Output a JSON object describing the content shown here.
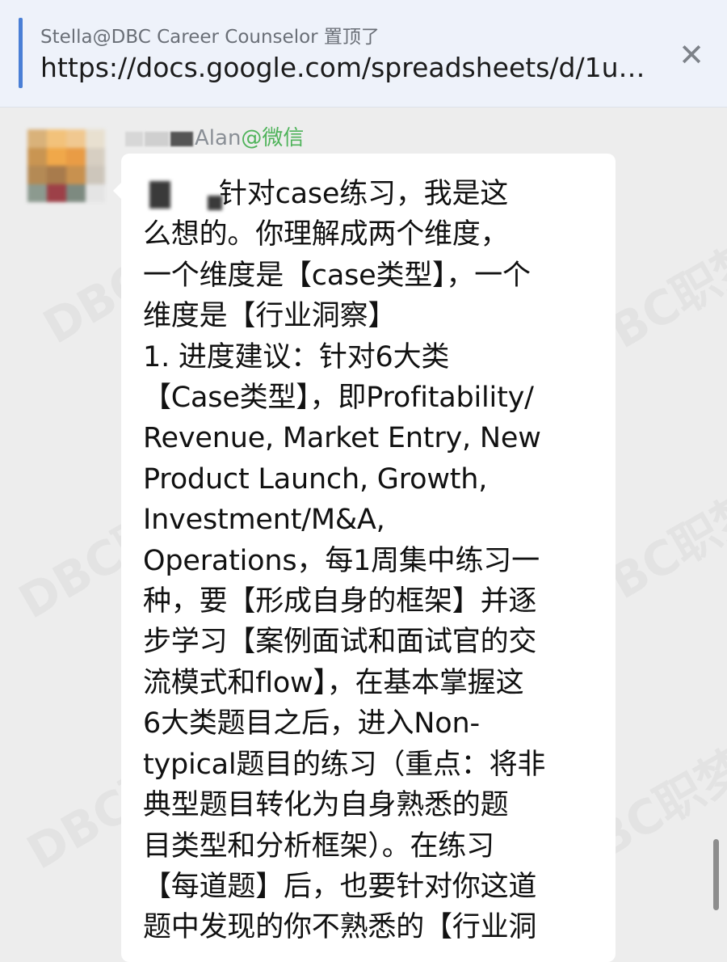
{
  "pinned": {
    "from_label": "Stella@DBC Career Counselor 置顶了",
    "url": "https://docs.google.com/spreadsheets/d/1uD...",
    "close_glyph": "✕"
  },
  "message": {
    "sender_name": "Alan",
    "sender_source": "@微信",
    "lines": [
      "针对case练习，我是这",
      "么想的。你理解成两个维度，",
      "一个维度是【case类型】，一个",
      "维度是【行业洞察】",
      "1. 进度建议：针对6大类",
      "【Case类型】，即Profitability/",
      "Revenue, Market Entry, New",
      "Product Launch, Growth,",
      "Investment/M&A,",
      "Operations，每1周集中练习一",
      "种，要【形成自身的框架】并逐",
      "步学习【案例面试和面试官的交",
      "流模式和flow】，在基本掌握这",
      "6大类题目之后，进入Non-",
      "typical题目的练习（重点：将非",
      "典型题目转化为自身熟悉的题",
      "目类型和分析框架）。在练习",
      "【每道题】后，也要针对你这道",
      "题中发现的你不熟悉的【行业洞"
    ]
  },
  "watermark": {
    "brand": "DBC职梦",
    "counselor": "Stella@DBC Career Counselor"
  }
}
